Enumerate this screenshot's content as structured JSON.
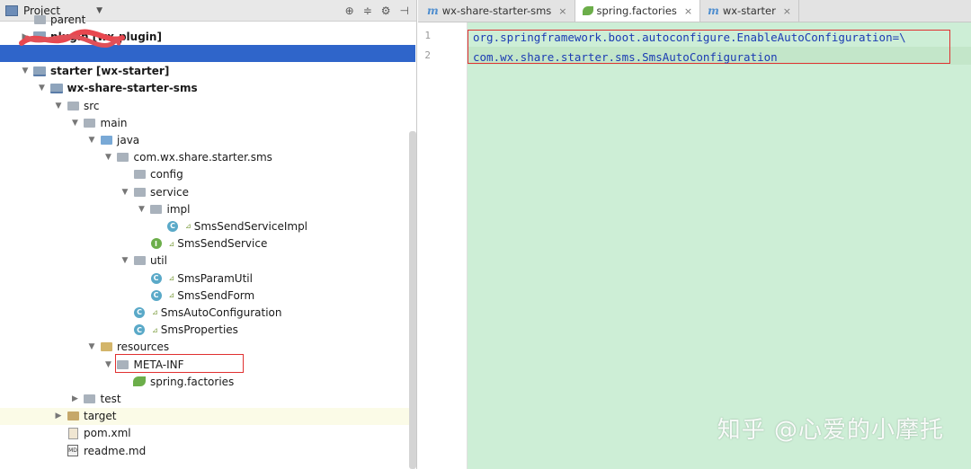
{
  "project_panel": {
    "title": "Project",
    "tree": [
      {
        "label": "parent",
        "bold": false,
        "kind": "folder",
        "arrow": "",
        "indent": 0
      },
      {
        "label": "plugin [wx-plugin]",
        "bold": true,
        "kind": "folder-module",
        "arrow": "▶",
        "indent": 0
      },
      {
        "label": "",
        "bold": false,
        "kind": "none",
        "arrow": "",
        "indent": 0,
        "selected": true
      },
      {
        "label": "starter [wx-starter]",
        "bold": true,
        "kind": "folder-module",
        "arrow": "▼",
        "indent": 0
      },
      {
        "label": "wx-share-starter-sms",
        "bold": true,
        "kind": "folder-module",
        "arrow": "▼",
        "indent": 1
      },
      {
        "label": "src",
        "bold": false,
        "kind": "folder",
        "arrow": "▼",
        "indent": 2
      },
      {
        "label": "main",
        "bold": false,
        "kind": "folder",
        "arrow": "▼",
        "indent": 3
      },
      {
        "label": "java",
        "bold": false,
        "kind": "folder-blue",
        "arrow": "▼",
        "indent": 4
      },
      {
        "label": "com.wx.share.starter.sms",
        "bold": false,
        "kind": "folder",
        "arrow": "▼",
        "indent": 5
      },
      {
        "label": "config",
        "bold": false,
        "kind": "folder",
        "arrow": "",
        "indent": 6
      },
      {
        "label": "service",
        "bold": false,
        "kind": "folder",
        "arrow": "▼",
        "indent": 6
      },
      {
        "label": "impl",
        "bold": false,
        "kind": "folder",
        "arrow": "▼",
        "indent": 7
      },
      {
        "label": "SmsSendServiceImpl",
        "bold": false,
        "kind": "class",
        "arrow": "",
        "indent": 8
      },
      {
        "label": "SmsSendService",
        "bold": false,
        "kind": "interface",
        "arrow": "",
        "indent": 7
      },
      {
        "label": "util",
        "bold": false,
        "kind": "folder",
        "arrow": "▼",
        "indent": 6
      },
      {
        "label": "SmsParamUtil",
        "bold": false,
        "kind": "class",
        "arrow": "",
        "indent": 7
      },
      {
        "label": "SmsSendForm",
        "bold": false,
        "kind": "class",
        "arrow": "",
        "indent": 7
      },
      {
        "label": "SmsAutoConfiguration",
        "bold": false,
        "kind": "class",
        "arrow": "",
        "indent": 6
      },
      {
        "label": "SmsProperties",
        "bold": false,
        "kind": "class",
        "arrow": "",
        "indent": 6
      },
      {
        "label": "resources",
        "bold": false,
        "kind": "folder-yellow",
        "arrow": "▼",
        "indent": 4
      },
      {
        "label": "META-INF",
        "bold": false,
        "kind": "folder",
        "arrow": "▼",
        "indent": 5
      },
      {
        "label": "spring.factories",
        "bold": false,
        "kind": "spring",
        "arrow": "",
        "indent": 6
      },
      {
        "label": "test",
        "bold": false,
        "kind": "folder",
        "arrow": "▶",
        "indent": 3
      },
      {
        "label": "target",
        "bold": false,
        "kind": "folder-orange",
        "arrow": "▶",
        "indent": 2,
        "highlight": true
      },
      {
        "label": "pom.xml",
        "bold": false,
        "kind": "maven",
        "arrow": "",
        "indent": 2
      },
      {
        "label": "readme.md",
        "bold": false,
        "kind": "md",
        "arrow": "",
        "indent": 2
      }
    ]
  },
  "editor": {
    "tabs": [
      {
        "label": "wx-share-starter-sms",
        "icon": "m",
        "active": false
      },
      {
        "label": "spring.factories",
        "icon": "spring",
        "active": true
      },
      {
        "label": "wx-starter",
        "icon": "m",
        "active": false
      }
    ],
    "line_numbers": [
      "1",
      "2"
    ],
    "lines": [
      "org.springframework.boot.autoconfigure.EnableAutoConfiguration=\\",
      "com.wx.share.starter.sms.SmsAutoConfiguration"
    ]
  },
  "watermark": "知乎 @心爱的小摩托",
  "colors": {
    "selection": "#2f65ca",
    "editor_bg": "#cdeed6",
    "highlight_box": "#e03030",
    "code_text": "#1b3bb3"
  }
}
